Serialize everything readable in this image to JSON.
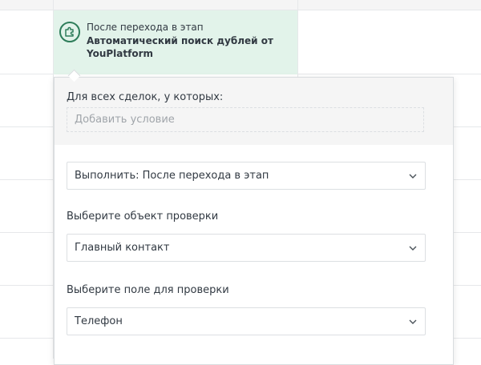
{
  "trigger": {
    "caption": "После перехода в этап",
    "name": "Автоматический поиск дублей от YouPlatform",
    "icon": "puzzle-icon"
  },
  "conditions": {
    "label": "Для всех сделок, у которых:",
    "add_placeholder": "Добавить условие"
  },
  "execute": {
    "value": "Выполнить: После перехода в этап"
  },
  "object": {
    "label": "Выберите объект проверки",
    "value": "Главный контакт"
  },
  "field": {
    "label": "Выберите поле для проверки",
    "value": "Телефон"
  },
  "colors": {
    "card_bg": "#e2f3ea",
    "accent": "#2e7d5a",
    "text": "#313942",
    "muted": "#a0a5aa"
  }
}
